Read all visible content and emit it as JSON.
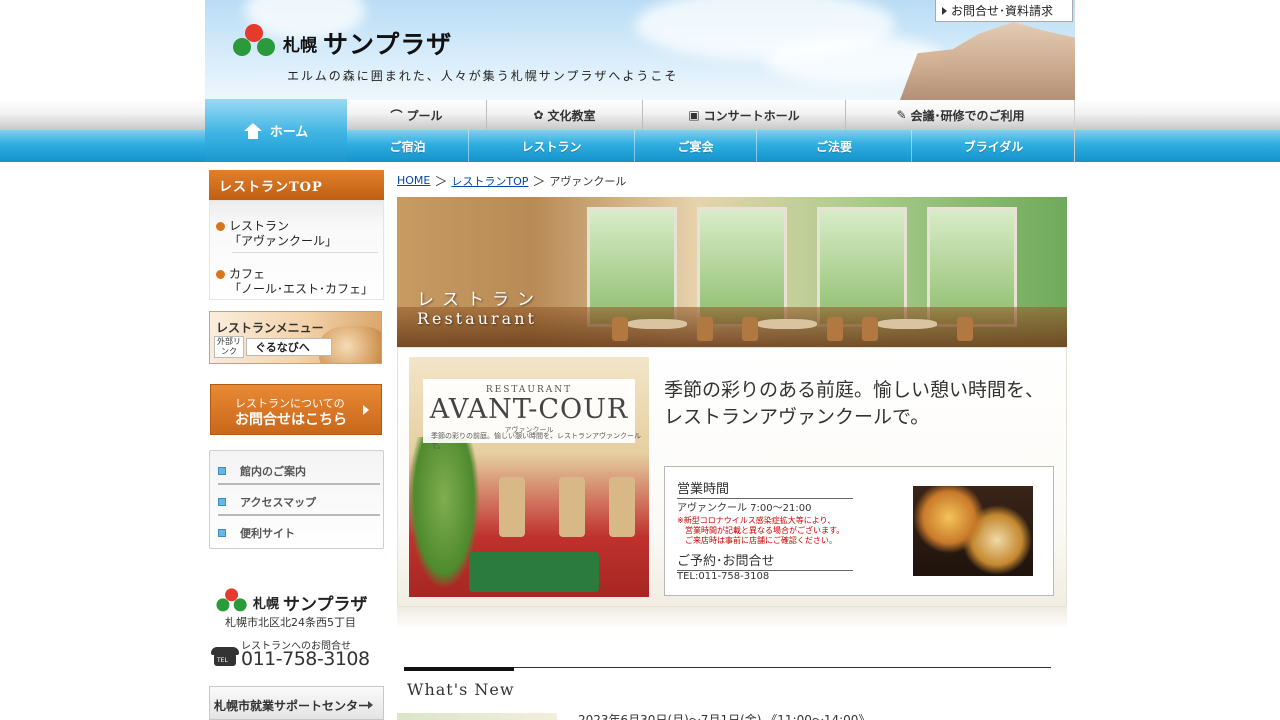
{
  "header": {
    "logo_city": "札幌",
    "logo_name": "サンプラザ",
    "tagline": "エルムの森に囲まれた、人々が集う札幌サンプラザへようこそ",
    "contact_link": "お問合せ･資料請求"
  },
  "nav": {
    "home": "ホーム",
    "row1": [
      "プール",
      "文化教室",
      "コンサートホール",
      "会議･研修でのご利用"
    ],
    "row2": [
      "ご宿泊",
      "レストラン",
      "ご宴会",
      "ご法要",
      "ブライダル"
    ]
  },
  "sidebar": {
    "title": "レストランTOP",
    "items": [
      {
        "line1": "レストラン",
        "line2": "「アヴァンクール」"
      },
      {
        "line1": "カフェ",
        "line2": "「ノール･エスト･カフェ」"
      }
    ],
    "menu_banner": {
      "title": "レストランメニュー",
      "external": "外部リンク",
      "gurunavi": "ぐるなびへ"
    },
    "inquiry": {
      "line1": "レストランについての",
      "line2": "お問合せはこちら"
    },
    "info_links": [
      "館内のご案内",
      "アクセスマップ",
      "便利サイト"
    ],
    "logo_city": "札幌",
    "logo_name": "サンプラザ",
    "address": "札幌市北区北24条西5丁目",
    "phone_label": "レストランへのお問合せ",
    "phone": "011-758-3108",
    "tel_icon_label": "TEL",
    "support_center": "札幌市就業サポートセンター"
  },
  "breadcrumb": {
    "home": "HOME",
    "restaurant_top": "レストランTOP",
    "current": "アヴァンクール",
    "separator": "＞"
  },
  "hero": {
    "title_jp": "レストラン",
    "title_en": "Restaurant"
  },
  "restaurant": {
    "sign_label": "RESTAURANT",
    "sign_name": "AVANT-COUR",
    "sign_kana": "アヴァンクール",
    "sign_sub": "季節の彩りの前庭。愉しい憩い時間を、レストランアヴァンクールで。",
    "catch_line1": "季節の彩りのある前庭。愉しい憩い時間を、",
    "catch_line2": "レストランアヴァンクールで。",
    "hours_heading": "営業時間",
    "hours_text": "アヴァンクール 7:00～21:00",
    "notice_line1": "※新型コロナウイルス感染症拡大等により、",
    "notice_line2": "営業時間が記載と異なる場合がございます。",
    "notice_line3": "ご来店時は事前に店舗にご確認ください。",
    "reserve_heading": "ご予約･お問合せ",
    "reserve_tel": "TEL:011-758-3108"
  },
  "news": {
    "title": "What's New",
    "first_item": "2023年6月30日(月)～7月1日(金) 《11:00～14:00》"
  },
  "colors": {
    "nav_blue": "#1592cc",
    "sidebar_orange": "#c05f12",
    "link_blue": "#0645ad",
    "notice_red": "#d10000"
  },
  "icons": [
    "home-icon",
    "pool-icon",
    "culture-icon",
    "concert-icon",
    "pencil-icon",
    "bullet-icon",
    "arrow-icon",
    "tel-icon"
  ]
}
